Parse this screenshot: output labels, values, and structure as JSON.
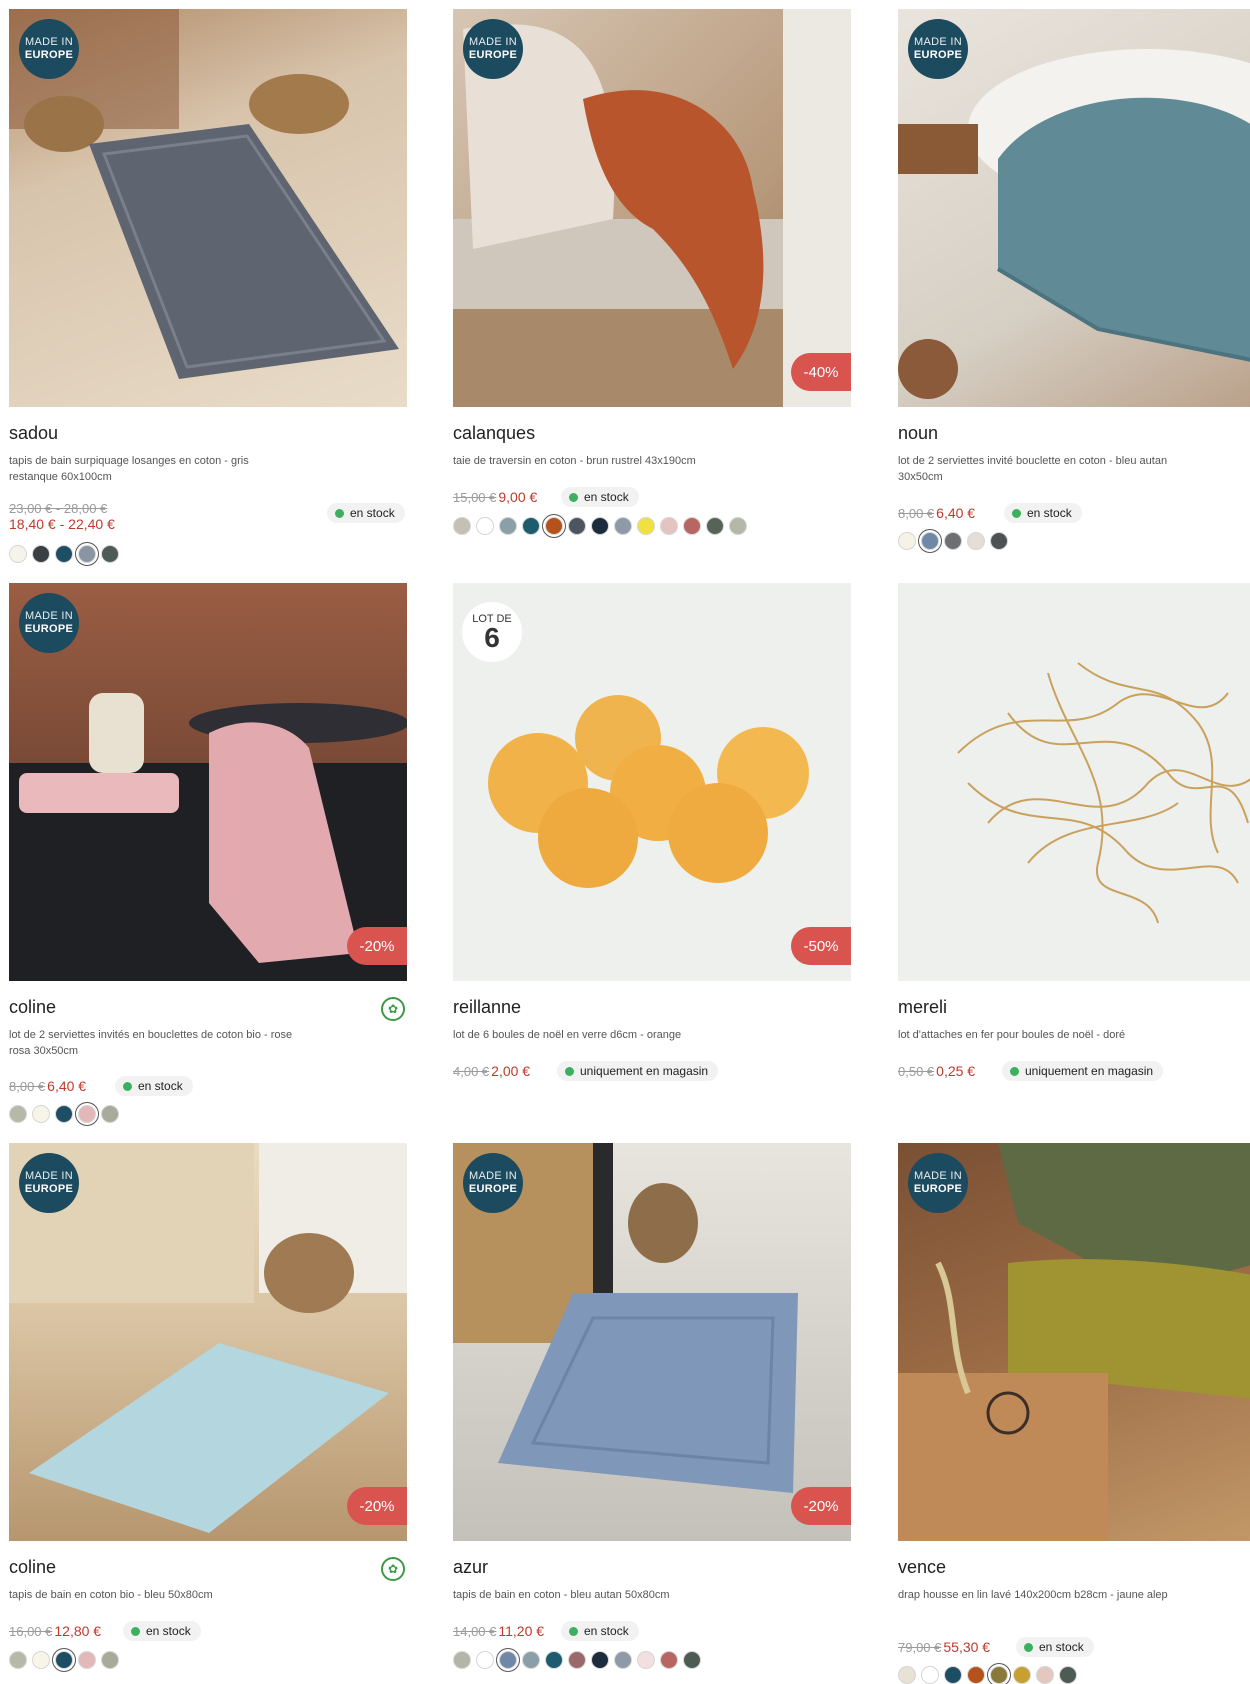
{
  "products": [
    {
      "badge": {
        "type": "europe",
        "line1": "MADE IN",
        "line2": "EUROPE"
      },
      "discount": "",
      "name": "sadou",
      "desc": "tapis de bain surpiquage losanges en coton - gris restanque 60x100cm",
      "old_price": "23,00 € - 28,00 €",
      "new_price": "18,40 € - 22,40 €",
      "stock": "en stock",
      "swatches": [
        "#f5f3ea",
        "#3a3f43",
        "#1d4e63",
        "#8a95a3",
        "#4d5a55"
      ],
      "selected_swatch": 3
    },
    {
      "badge": {
        "type": "europe",
        "line1": "MADE IN",
        "line2": "EUROPE"
      },
      "discount": "-40%",
      "name": "calanques",
      "desc": "taie de traversin en coton - brun rustrel 43x190cm",
      "old_price": "15,00 €",
      "new_price": "9,00 €",
      "stock": "en stock",
      "swatches": [
        "#c4c0b4",
        "#ffffff",
        "#8aa0a6",
        "#1d5c6e",
        "#b5521c",
        "#4d5560",
        "#1c2c3d",
        "#8e9aa8",
        "#f1e040",
        "#e3c4c0",
        "#b86662",
        "#566356",
        "#b4b8a8"
      ],
      "selected_swatch": 4
    },
    {
      "badge": {
        "type": "europe",
        "line1": "MADE IN",
        "line2": "EUROPE"
      },
      "discount": "",
      "name": "noun",
      "desc": "lot de 2 serviettes invité bouclette en coton - bleu autan 30x50cm",
      "old_price": "8,00 €",
      "new_price": "6,40 €",
      "stock": "en stock",
      "swatches": [
        "#f6f3e6",
        "#6f88a8",
        "#6e6f73",
        "#e4ddd8",
        "#4c5254"
      ],
      "selected_swatch": 1
    },
    {
      "badge": {
        "type": "europe",
        "line1": "MADE IN",
        "line2": "EUROPE"
      },
      "discount": "-20%",
      "name": "coline",
      "desc": "lot de 2 serviettes invités en bouclettes de coton bio - rose rosa 30x50cm",
      "old_price": "8,00 €",
      "new_price": "6,40 €",
      "stock": "en stock",
      "swatches": [
        "#b6b8a8",
        "#f7f5e8",
        "#1e4e63",
        "#e3b8b8",
        "#a7ab9a"
      ],
      "selected_swatch": 3
    },
    {
      "badge": {
        "type": "lot",
        "line1": "LOT DE",
        "line2": "6"
      },
      "discount": "-50%",
      "name": "reillanne",
      "desc": "lot de 6 boules de noël en verre d6cm - orange",
      "old_price": "4,00 €",
      "new_price": "2,00 €",
      "stock": "uniquement en magasin",
      "swatches": [],
      "selected_swatch": -1
    },
    {
      "badge": {
        "type": "none"
      },
      "discount": "",
      "name": "mereli",
      "desc": "lot d'attaches en fer pour boules de noël - doré",
      "old_price": "0,50 €",
      "new_price": "0,25 €",
      "stock": "uniquement en magasin",
      "swatches": [],
      "selected_swatch": -1
    },
    {
      "badge": {
        "type": "europe",
        "line1": "MADE IN",
        "line2": "EUROPE"
      },
      "discount": "-20%",
      "name": "coline",
      "desc": "tapis de bain en coton bio - bleu 50x80cm",
      "old_price": "16,00 €",
      "new_price": "12,80 €",
      "stock": "en stock",
      "swatches": [
        "#b6b8a8",
        "#f7f5e8",
        "#1e4e63",
        "#e3b8b8",
        "#a7ab9a"
      ],
      "selected_swatch": 2
    },
    {
      "badge": {
        "type": "europe",
        "line1": "MADE IN",
        "line2": "EUROPE"
      },
      "discount": "-20%",
      "name": "azur",
      "desc": "tapis de bain en coton - bleu autan 50x80cm",
      "old_price": "14,00 €",
      "new_price": "11,20 €",
      "stock": "en stock",
      "swatches": [
        "#b3b5a6",
        "#ffffff",
        "#6f88a8",
        "#8aa0a6",
        "#1d5c6e",
        "#9a6a6a",
        "#1c2c3d",
        "#8e9aa8",
        "#f2dfe0",
        "#b86662",
        "#4e5a54"
      ],
      "selected_swatch": 2
    },
    {
      "badge": {
        "type": "europe",
        "line1": "MADE IN",
        "line2": "EUROPE"
      },
      "discount": "",
      "name": "vence",
      "desc": "drap housse en lin lavé 140x200cm b28cm - jaune alep",
      "old_price": "79,00 €",
      "new_price": "55,30 €",
      "stock": "en stock",
      "swatches": [
        "#e8e2d4",
        "#ffffff",
        "#1d4e63",
        "#b5521c",
        "#8a7a3a",
        "#c8a032",
        "#e4c8c0",
        "#4e5a54"
      ],
      "selected_swatch": 4
    }
  ]
}
